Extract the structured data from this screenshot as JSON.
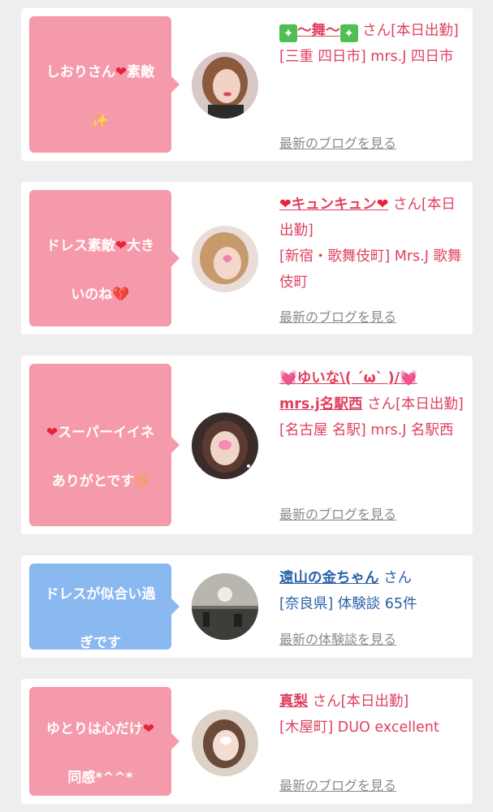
{
  "cards": [
    {
      "bubble_pre": "しおりさん",
      "bubble_mid": "素敵",
      "name_pre": "〜舞〜",
      "san": "さん[本日出勤]",
      "meta": "[三重 四日市] mrs.J 四日市",
      "link": "最新のブログを見る"
    },
    {
      "bubble_pre": "ドレス素敵",
      "bubble_mid": "大き",
      "bubble_post": "いのね",
      "name_mid": "キュンキュン",
      "san": "さん[本日出勤]",
      "meta": "[新宿・歌舞伎町] Mrs.J 歌舞伎町",
      "link": "最新のブログを見る"
    },
    {
      "bubble_pre": "スーパーイイネ",
      "bubble_post": "ありがとです",
      "name_mid": "ゆいな\\( ´ω` )/",
      "name_post": "mrs.j名駅西",
      "san": "さん[本日出勤]",
      "meta": "[名古屋 名駅] mrs.J 名駅西",
      "link": "最新のブログを見る"
    },
    {
      "bubble_pre": "ドレスが似合い過",
      "bubble_post": "ぎです",
      "name_pre": "遠山の金ちゃん",
      "san": "さん",
      "meta": "[奈良県] 体験談 65件",
      "link": "最新の体験談を見る"
    },
    {
      "bubble_pre": "ゆとりは心だけ",
      "bubble_post": "同感*^^*",
      "name_pre": "真梨",
      "san": "さん[本日出勤]",
      "meta": "[木屋町] DUO excellent",
      "link": "最新のブログを見る"
    }
  ],
  "colors": {
    "pink_bubble": "#f59aaa",
    "blue_bubble": "#8ab8f0",
    "name_pink": "#e0405f",
    "name_blue": "#2a62a8",
    "link_gray": "#8a8a8a"
  },
  "icons": [
    "heart-icon",
    "sparkle-icon",
    "broken-heart-icon",
    "pink-heart-icon",
    "kiss-face-icon",
    "green-sparkle-icon"
  ]
}
